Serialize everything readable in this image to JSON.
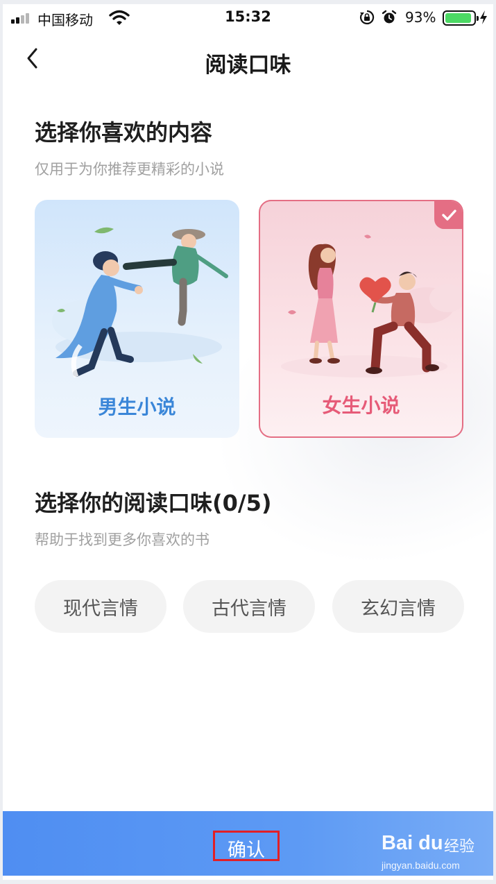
{
  "status_bar": {
    "carrier": "中国移动",
    "time": "15:32",
    "battery_percent": "93%",
    "battery_level": 0.93,
    "icons": [
      "signal-icon",
      "wifi-icon",
      "rotation-lock-icon",
      "alarm-icon",
      "battery-icon",
      "charging-icon"
    ]
  },
  "nav": {
    "back_icon": "chevron-left-icon",
    "title": "阅读口味"
  },
  "content_section": {
    "title": "选择你喜欢的内容",
    "subtitle": "仅用于为你推荐更精彩的小说",
    "cards": [
      {
        "label": "男生小说",
        "selected": false,
        "color": "#3a86d8"
      },
      {
        "label": "女生小说",
        "selected": true,
        "color": "#e65b78"
      }
    ]
  },
  "taste_section": {
    "title": "选择你的阅读口味(0/5)",
    "subtitle": "帮助于找到更多你喜欢的书",
    "chips": [
      "现代言情",
      "古代言情",
      "玄幻言情"
    ]
  },
  "footer": {
    "confirm_label": "确认",
    "accent_color": "#4f8ef2",
    "highlight_color": "#e21f26"
  },
  "watermark": {
    "logo": "Bai du",
    "text": "经验",
    "url": "jingyan.baidu.com"
  }
}
